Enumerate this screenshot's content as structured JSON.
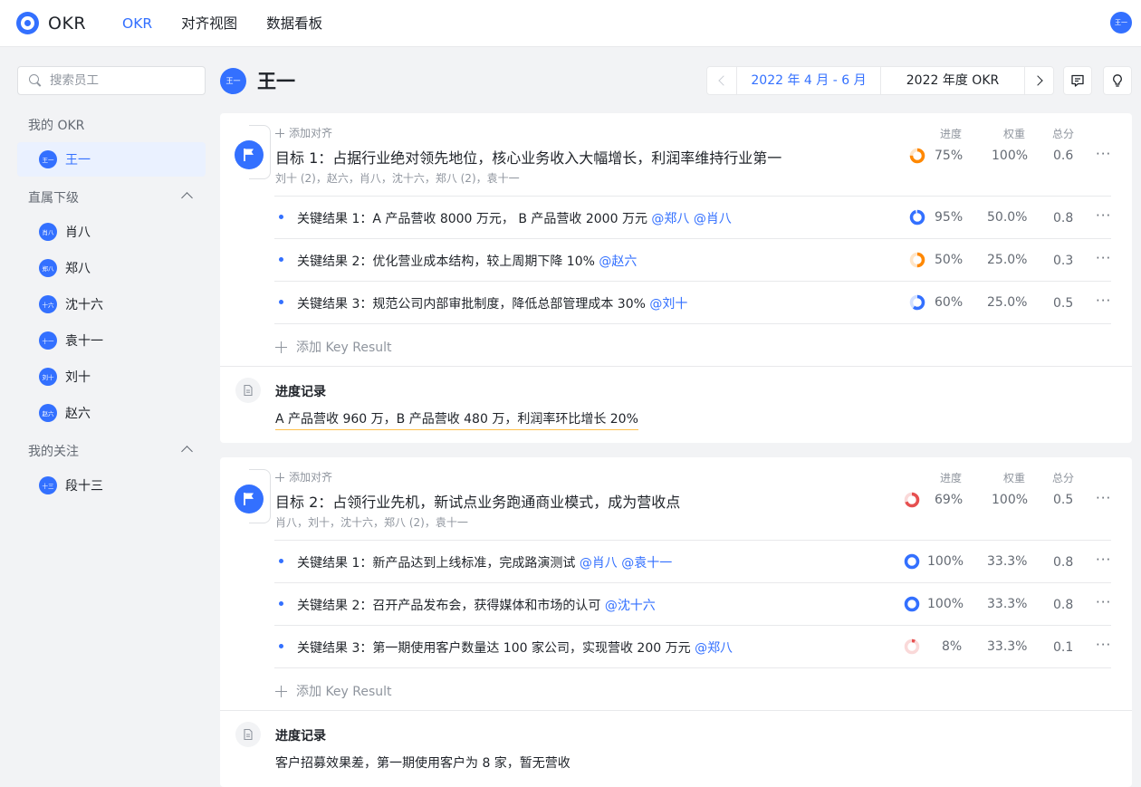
{
  "app": {
    "logo_text": "OKR",
    "user_avatar": "王一"
  },
  "nav": [
    {
      "label": "OKR",
      "active": true
    },
    {
      "label": "对齐视图",
      "active": false
    },
    {
      "label": "数据看板",
      "active": false
    }
  ],
  "sidebar": {
    "search_placeholder": "搜索员工",
    "my_okr_label": "我的 OKR",
    "me": {
      "avatar": "王一",
      "name": "王一"
    },
    "reports_label": "直属下级",
    "reports": [
      {
        "avatar": "肖八",
        "name": "肖八"
      },
      {
        "avatar": "郑八",
        "name": "郑八"
      },
      {
        "avatar": "十六",
        "name": "沈十六"
      },
      {
        "avatar": "十一",
        "name": "袁十一"
      },
      {
        "avatar": "刘十",
        "name": "刘十"
      },
      {
        "avatar": "赵六",
        "name": "赵六"
      }
    ],
    "follow_label": "我的关注",
    "follows": [
      {
        "avatar": "十三",
        "name": "段十三"
      }
    ]
  },
  "header": {
    "avatar": "王一",
    "name": "王一",
    "period_selected": "2022 年 4 月 - 6 月",
    "period_year": "2022 年度 OKR"
  },
  "columns": {
    "progress": "进度",
    "weight": "权重",
    "score": "总分"
  },
  "labels": {
    "add_align": "添加对齐",
    "add_kr": "添加 Key Result",
    "progress_record": "进度记录",
    "more": "···"
  },
  "objectives": [
    {
      "title": "目标 1：占据行业绝对领先地位，核心业务收入大幅增长，利润率维持行业第一",
      "members": "刘十 (2)，赵六，肖八，沈十六，郑八 (2)，袁十一",
      "progress": 75,
      "progress_text": "75%",
      "weight": "100%",
      "score": "0.6",
      "ring_color": "#ff8800",
      "krs": [
        {
          "text": "关键结果 1：A 产品营收 8000 万元， B 产品营收 2000 万元",
          "mentions": "@郑八 @肖八",
          "progress": 95,
          "progress_text": "95%",
          "weight": "50.0%",
          "score": "0.8",
          "ring_color": "#3370ff"
        },
        {
          "text": "关键结果 2：优化营业成本结构，较上周期下降 10%",
          "mentions": "@赵六",
          "progress": 50,
          "progress_text": "50%",
          "weight": "25.0%",
          "score": "0.3",
          "ring_color": "#ff8800"
        },
        {
          "text": "关键结果 3：规范公司内部审批制度，降低总部管理成本 30%",
          "mentions": "@刘十",
          "progress": 60,
          "progress_text": "60%",
          "weight": "25.0%",
          "score": "0.5",
          "ring_color": "#3370ff"
        }
      ],
      "record": "A 产品营收 960 万，B 产品营收 480 万，利润率环比增长 20%"
    },
    {
      "title": "目标 2：占领行业先机，新试点业务跑通商业模式，成为营收点",
      "members": "肖八，刘十，沈十六，郑八 (2)，袁十一",
      "progress": 69,
      "progress_text": "69%",
      "weight": "100%",
      "score": "0.5",
      "ring_color": "#e65050",
      "krs": [
        {
          "text": "关键结果 1：新产品达到上线标准，完成路演测试",
          "mentions": "@肖八 @袁十一",
          "progress": 100,
          "progress_text": "100%",
          "weight": "33.3%",
          "score": "0.8",
          "ring_color": "#3370ff"
        },
        {
          "text": "关键结果 2：召开产品发布会，获得媒体和市场的认可",
          "mentions": "@沈十六",
          "progress": 100,
          "progress_text": "100%",
          "weight": "33.3%",
          "score": "0.8",
          "ring_color": "#3370ff"
        },
        {
          "text": "关键结果 3：第一期使用客户数量达 100 家公司，实现营收 200 万元",
          "mentions": "@郑八",
          "progress": 8,
          "progress_text": "8%",
          "weight": "33.3%",
          "score": "0.1",
          "ring_color": "#e65050"
        }
      ],
      "record": "客户招募效果差，第一期使用客户为 8 家，暂无营收"
    }
  ],
  "colors": {
    "accent": "#3370ff",
    "text": "#1f2329",
    "muted": "#8f959e",
    "bg": "#f2f3f5"
  }
}
